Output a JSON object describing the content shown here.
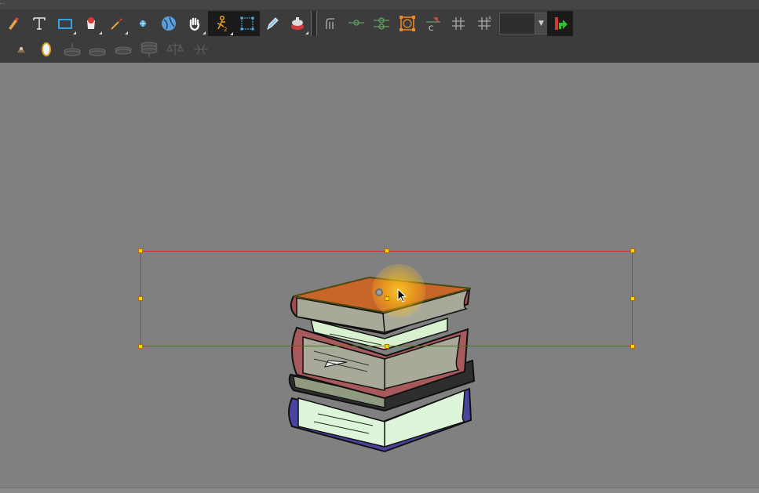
{
  "app": {
    "accent_active": "#1b1b1b",
    "selection_color": "#d42b2b",
    "handle_color": "#ffd400",
    "canvas_bg": "#808080"
  },
  "toolbar": {
    "row1": [
      {
        "icon": "brush-icon"
      },
      {
        "icon": "text-tool-icon"
      },
      {
        "icon": "rectangle-tool-icon"
      },
      {
        "icon": "paint-bucket-icon"
      },
      {
        "icon": "dropper-icon"
      },
      {
        "icon": "contour-editor-icon"
      },
      {
        "icon": "cutter-icon"
      },
      {
        "icon": "hand-icon"
      },
      {
        "icon": "animate-tool-icon",
        "active": true
      },
      {
        "icon": "transform-tool-icon",
        "active": true
      },
      {
        "icon": "pencil-editor-icon"
      },
      {
        "icon": "paint-pot-icon"
      },
      {
        "icon": "rigging-icon"
      },
      {
        "icon": "ik-chain-icon"
      },
      {
        "icon": "bone-icon"
      },
      {
        "icon": "envelope-icon"
      },
      {
        "icon": "constraint-icon"
      },
      {
        "icon": "peg-icon"
      },
      {
        "icon": "peg-alt-icon"
      },
      {
        "icon": "reposition-icon"
      }
    ],
    "row2": [
      {
        "icon": "magnet-icon"
      },
      {
        "icon": "onion-skin-icon"
      },
      {
        "icon": "disc-stack-1-icon"
      },
      {
        "icon": "disc-stack-2-icon"
      },
      {
        "icon": "disc-stack-3-icon"
      },
      {
        "icon": "disc-stack-4-icon"
      },
      {
        "icon": "balance-icon"
      },
      {
        "icon": "flip-icon"
      }
    ],
    "dropdown": {
      "value": ""
    }
  }
}
